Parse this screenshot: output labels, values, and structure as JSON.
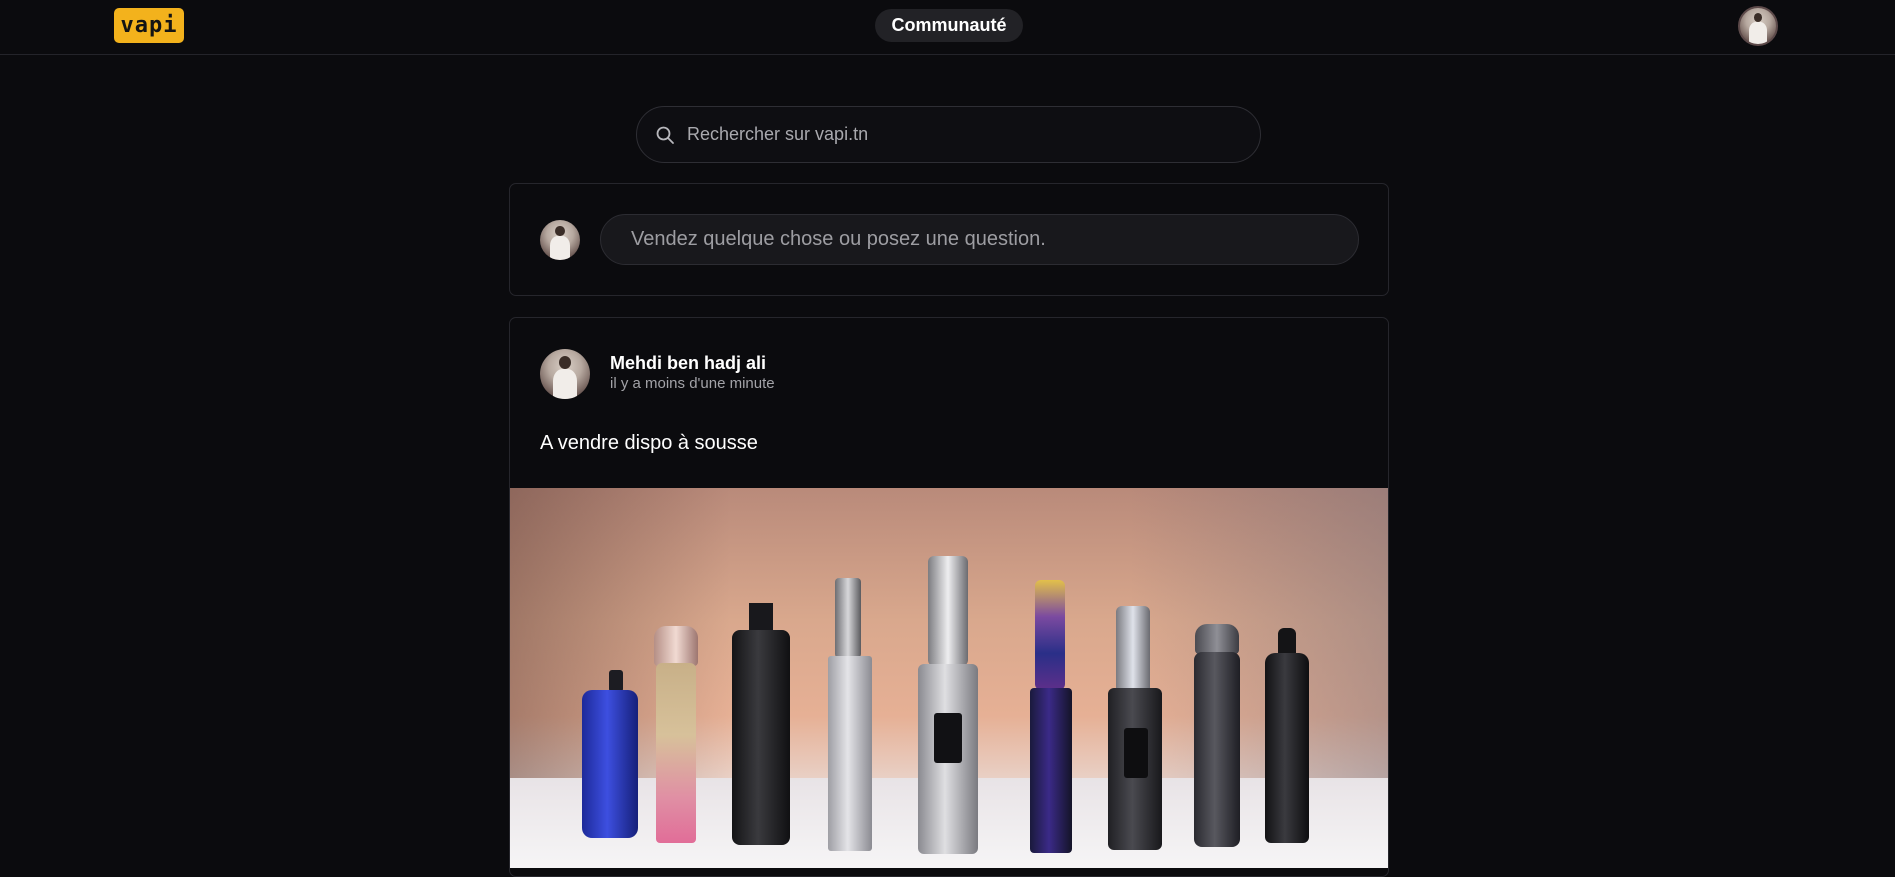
{
  "header": {
    "logo_text": "vapi",
    "nav_label": "Communauté",
    "logo_color": "#f3b21c",
    "avatar_icon": "user-avatar"
  },
  "search": {
    "placeholder": "Rechercher sur vapi.tn",
    "icon": "search-icon"
  },
  "composer": {
    "placeholder": "Vendez quelque chose ou posez une question."
  },
  "post": {
    "author": "Mehdi ben hadj ali",
    "time": "il y a moins d'une minute",
    "text": "A vendre dispo à sousse",
    "image_subject": "vape-devices-photo"
  }
}
